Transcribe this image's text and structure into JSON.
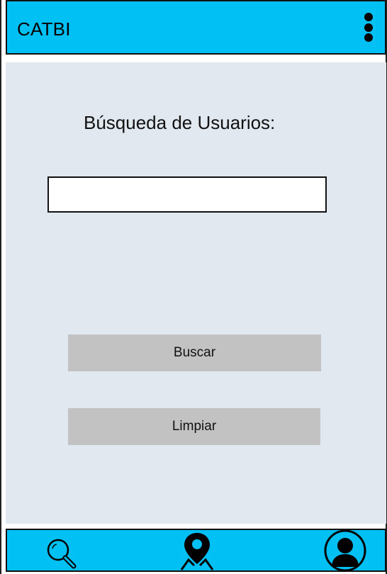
{
  "app_bar": {
    "title": "CATBI",
    "menu_icon": "kebab-menu-icon"
  },
  "search": {
    "heading": "Búsqueda de Usuarios:",
    "input_value": "",
    "input_placeholder": ""
  },
  "buttons": {
    "search_label": "Buscar",
    "clear_label": "Limpiar"
  },
  "bottom_nav": {
    "items": [
      {
        "icon": "search-icon"
      },
      {
        "icon": "map-pin-icon"
      },
      {
        "icon": "user-profile-icon"
      }
    ]
  },
  "colors": {
    "primary": "#00c0f4",
    "background": "#e2e8f0",
    "button": "#c2c2c2"
  }
}
